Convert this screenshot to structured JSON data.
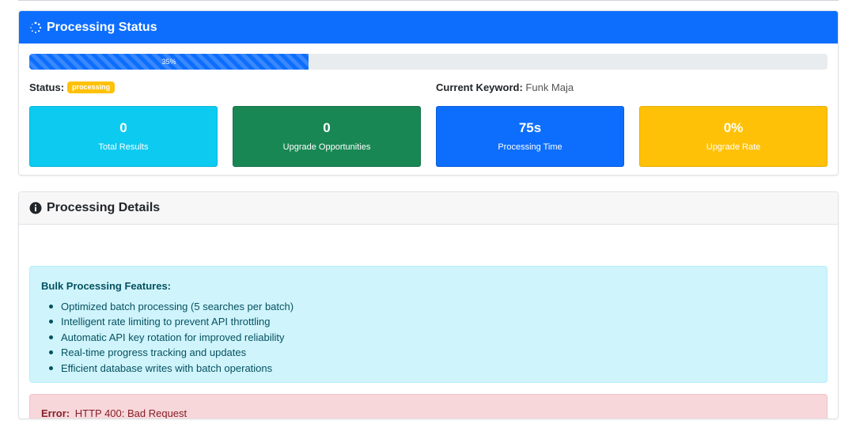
{
  "status_card": {
    "title": "Processing Status",
    "icon": "spinner-icon",
    "progress_percent": 35,
    "progress_label": "35%",
    "status_label": "Status:",
    "status_badge": "processing",
    "keyword_label": "Current Keyword:",
    "keyword_value": "Funk Maja",
    "stats": [
      {
        "value": "0",
        "label": "Total Results",
        "color": "#0dcaf0"
      },
      {
        "value": "0",
        "label": "Upgrade Opportunities",
        "color": "#198754"
      },
      {
        "value": "75s",
        "label": "Processing Time",
        "color": "#0d6efd"
      },
      {
        "value": "0%",
        "label": "Upgrade Rate",
        "color": "#ffc107"
      }
    ]
  },
  "details_card": {
    "title": "Processing Details",
    "icon": "info-circle-icon",
    "features_title": "Bulk Processing Features:",
    "features": [
      "Optimized batch processing (5 searches per batch)",
      "Intelligent rate limiting to prevent API throttling",
      "Automatic API key rotation for improved reliability",
      "Real-time progress tracking and updates",
      "Efficient database writes with batch operations"
    ],
    "error_label": "Error:",
    "error_message": "HTTP 400: Bad Request"
  }
}
